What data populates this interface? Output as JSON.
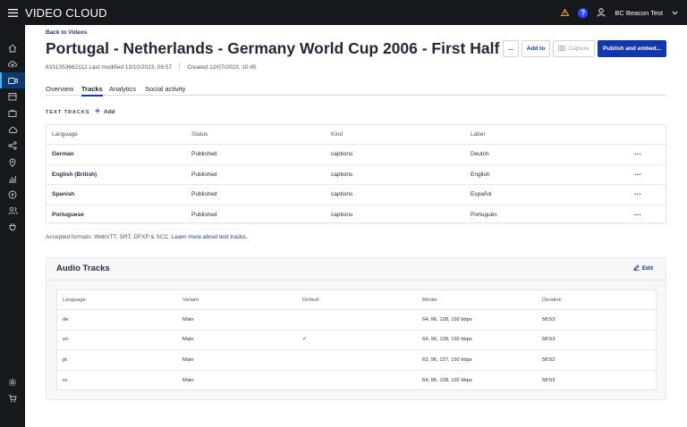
{
  "topbar": {
    "brand": "VIDEO CLOUD",
    "user_name": "BC Beacon Test",
    "help_glyph": "?"
  },
  "sidebar": {
    "icons": [
      "home-icon",
      "upload-icon",
      "video-icon",
      "schedule-icon",
      "tv-icon",
      "cloud-icon",
      "share-icon",
      "location-icon",
      "analytics-icon",
      "play-icon",
      "users-icon",
      "plugin-icon",
      "settings-icon",
      "cart-icon"
    ],
    "active": "video-icon"
  },
  "header": {
    "back_link": "Back to Videos",
    "title": "Portugal - Netherlands - Germany World Cup 2006 - First Half",
    "video_id_modified": "6331053662112 Last modified 13/10/2023, 09:57",
    "created": "Created 12/07/2023, 10:45",
    "more_label": "...",
    "add_to_label": "Add to",
    "capture_label": "Capture",
    "publish_label": "Publish and embed..."
  },
  "tabs": [
    {
      "label": "Overview",
      "active": false
    },
    {
      "label": "Tracks",
      "active": true
    },
    {
      "label": "Analytics",
      "active": false
    },
    {
      "label": "Social activity",
      "active": false
    }
  ],
  "text_tracks": {
    "section_label": "TEXT TRACKS",
    "add_label": "Add",
    "columns": [
      "Language",
      "Status",
      "Kind",
      "Label"
    ],
    "rows": [
      {
        "language": "German",
        "status": "Published",
        "kind": "captions",
        "label": "Deutch"
      },
      {
        "language": "English (British)",
        "status": "Published",
        "kind": "captions",
        "label": "English"
      },
      {
        "language": "Spanish",
        "status": "Published",
        "kind": "captions",
        "label": "Español"
      },
      {
        "language": "Portuguese",
        "status": "Published",
        "kind": "captions",
        "label": "Português"
      }
    ],
    "row_more": "···",
    "formats_text": "Accepted formats: WebVTT, SRT, DFXP & SCC.",
    "formats_link": "Learn more about text tracks."
  },
  "audio_tracks": {
    "title": "Audio Tracks",
    "edit_label": "Edit",
    "columns": [
      "Language",
      "Variant",
      "Default",
      "Bitrate",
      "Duration"
    ],
    "rows": [
      {
        "language": "de",
        "variant": "Main",
        "default": "",
        "bitrate": "64, 96, 128, 192 kbps",
        "duration": "58:53"
      },
      {
        "language": "en",
        "variant": "Main",
        "default": "✓",
        "bitrate": "64, 96, 128, 192 kbps",
        "duration": "58:53"
      },
      {
        "language": "pt",
        "variant": "Main",
        "default": "",
        "bitrate": "63, 96, 127, 192 kbps",
        "duration": "58:53"
      },
      {
        "language": "ru",
        "variant": "Main",
        "default": "",
        "bitrate": "64, 96, 128, 192 kbps",
        "duration": "58:53"
      }
    ]
  },
  "colors": {
    "nav_bg": "#15181d",
    "primary": "#1237a8",
    "link": "#1b3a8a",
    "warning": "#f5b400",
    "help": "#2b4cff"
  }
}
